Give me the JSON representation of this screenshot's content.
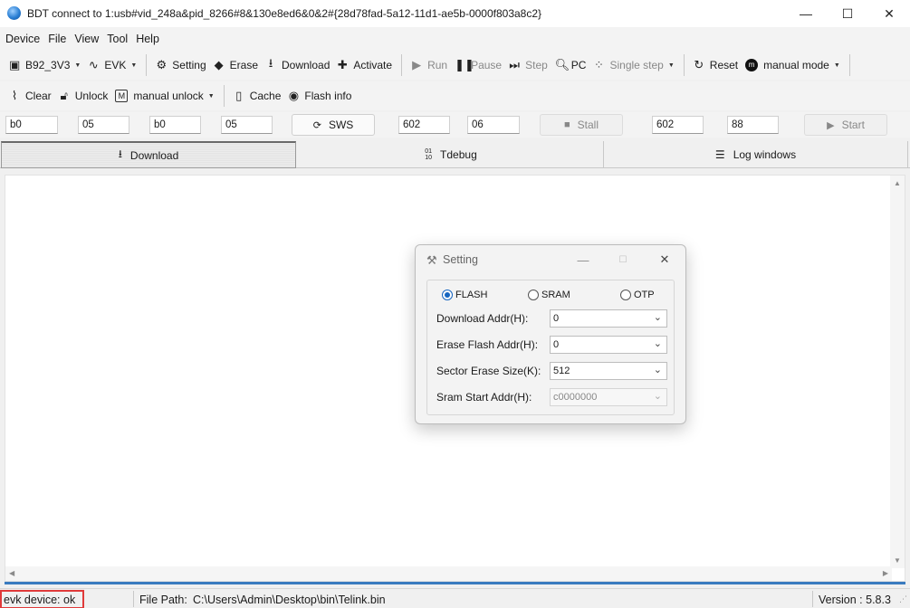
{
  "window": {
    "title": "BDT connect to 1:usb#vid_248a&pid_8266#8&130e8ed6&0&2#{28d78fad-5a12-11d1-ae5b-0000f803a8c2}",
    "minimize": "—",
    "maximize": "☐",
    "close": "✕"
  },
  "menu": [
    "Device",
    "File",
    "View",
    "Tool",
    "Help"
  ],
  "toolbar1": {
    "chip": "B92_3V3",
    "evk": "EVK",
    "setting": "Setting",
    "erase": "Erase",
    "download": "Download",
    "activate": "Activate",
    "run": "Run",
    "pause": "Pause",
    "step": "Step",
    "pc": "PC",
    "single_step": "Single step",
    "reset": "Reset",
    "mode": "manual mode"
  },
  "toolbar2": {
    "clear": "Clear",
    "unlock": "Unlock",
    "manual_unlock": "manual unlock",
    "cache": "Cache",
    "flash_info": "Flash info"
  },
  "params": {
    "f1": "b0",
    "f2": "05",
    "f3": "b0",
    "f4": "05",
    "sws": "SWS",
    "f5": "602",
    "f6": "06",
    "stall": "Stall",
    "f7": "602",
    "f8": "88",
    "start": "Start"
  },
  "tabs": {
    "download": "Download",
    "tdebug": "Tdebug",
    "log": "Log windows"
  },
  "status": {
    "device": "evk device: ok",
    "file_path_label": "File Path:",
    "file_path": "C:\\Users\\Admin\\Desktop\\bin\\Telink.bin",
    "version": "Version : 5.8.3"
  },
  "dialog": {
    "title": "Setting",
    "radios": {
      "flash": "FLASH",
      "sram": "SRAM",
      "otp": "OTP",
      "selected": "FLASH"
    },
    "download_addr_label": "Download  Addr(H):",
    "download_addr": "0",
    "erase_addr_label": "Erase Flash Addr(H):",
    "erase_addr": "0",
    "sector_size_label": "Sector Erase Size(K):",
    "sector_size": "512",
    "sram_addr_label": "Sram Start Addr(H):",
    "sram_addr": "c0000000"
  }
}
